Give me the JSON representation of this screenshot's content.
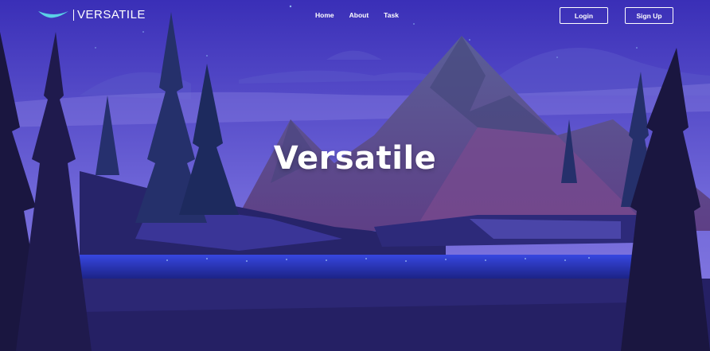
{
  "brand": {
    "name": "VERSATILE",
    "logo_icon": "bird-wing-icon"
  },
  "nav": {
    "links": [
      "Home",
      "About",
      "Task"
    ]
  },
  "buttons": {
    "login_label": "Login",
    "signup_label": "Sign Up"
  },
  "hero": {
    "title": "Versatile"
  },
  "colors": {
    "sky_top": "#3a2fb7",
    "sky_bottom": "#7b72e0",
    "mountain": "#6b4a9a",
    "water": "#2a3bd0",
    "tree": "#1a1640",
    "logo_accent": "#5ad0e6"
  }
}
